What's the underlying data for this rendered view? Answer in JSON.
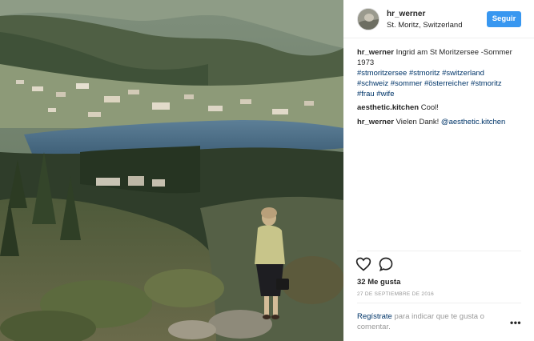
{
  "post": {
    "username": "hr_werner",
    "location": "St. Moritz, Switzerland",
    "follow_label": "Seguir"
  },
  "comments": [
    {
      "user": "hr_werner",
      "text": "Ingrid am St Moritzersee -Sommer 1973",
      "hashtags": [
        "#stmoritzersee",
        "#stmoritz",
        "#switzerland",
        "#schweiz",
        "#sommer",
        "#österreicher",
        "#stmoritz",
        "#frau",
        "#wife"
      ]
    },
    {
      "user": "aesthetic.kitchen",
      "text": "Cool!"
    },
    {
      "user": "hr_werner",
      "text": "Vielen Dank!",
      "mention": "@aesthetic.kitchen"
    }
  ],
  "actions": {
    "like_icon": "heart-icon",
    "comment_icon": "comment-icon"
  },
  "likes": "32 Me gusta",
  "date": "27 DE SEPTIEMBRE DE 2016",
  "login": {
    "link": "Regístrate",
    "text": "para indicar que te gusta o comentar."
  },
  "more_icon": "more-options-icon"
}
